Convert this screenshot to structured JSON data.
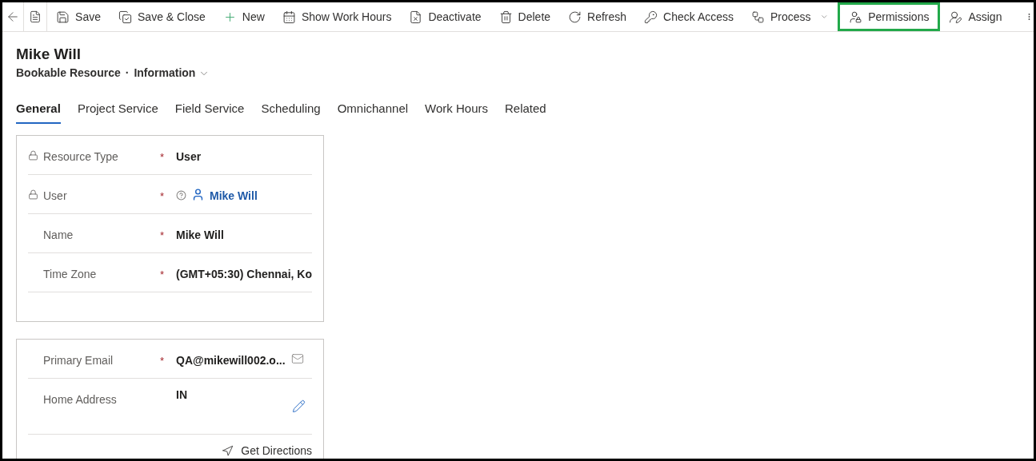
{
  "toolbar": {
    "items": [
      {
        "label": "Save",
        "highlighted": false
      },
      {
        "label": "Save & Close",
        "highlighted": false
      },
      {
        "label": "New",
        "highlighted": false
      },
      {
        "label": "Show Work Hours",
        "highlighted": false
      },
      {
        "label": "Deactivate",
        "highlighted": false
      },
      {
        "label": "Delete",
        "highlighted": false
      },
      {
        "label": "Refresh",
        "highlighted": false
      },
      {
        "label": "Check Access",
        "highlighted": false
      },
      {
        "label": "Process",
        "highlighted": false
      },
      {
        "label": "Permissions",
        "highlighted": true
      },
      {
        "label": "Assign",
        "highlighted": false
      }
    ]
  },
  "header": {
    "title": "Mike Will",
    "entity": "Bookable Resource",
    "separator": "·",
    "form": "Information"
  },
  "tabs": [
    {
      "label": "General",
      "selected": true
    },
    {
      "label": "Project Service",
      "selected": false
    },
    {
      "label": "Field Service",
      "selected": false
    },
    {
      "label": "Scheduling",
      "selected": false
    },
    {
      "label": "Omnichannel",
      "selected": false
    },
    {
      "label": "Work Hours",
      "selected": false
    },
    {
      "label": "Related",
      "selected": false
    }
  ],
  "sections": [
    {
      "fields": [
        {
          "label": "Resource Type",
          "locked": true,
          "required_mark": "*",
          "kind": "text",
          "value": "User"
        },
        {
          "label": "User",
          "locked": true,
          "required_mark": "*",
          "kind": "lookup",
          "value": "Mike Will"
        },
        {
          "label": "Name",
          "locked": false,
          "required_mark": "*",
          "kind": "text",
          "value": "Mike Will"
        },
        {
          "label": "Time Zone",
          "locked": false,
          "required_mark": "*",
          "kind": "text",
          "value": "(GMT+05:30) Chennai, Ko"
        }
      ]
    },
    {
      "fields": [
        {
          "label": "Primary Email",
          "locked": false,
          "required_mark": "*",
          "kind": "email",
          "value": "QA@mikewill002.o..."
        },
        {
          "label": "Home Address",
          "locked": false,
          "kind": "address",
          "value": "IN",
          "action": "Get Directions"
        }
      ]
    }
  ]
}
